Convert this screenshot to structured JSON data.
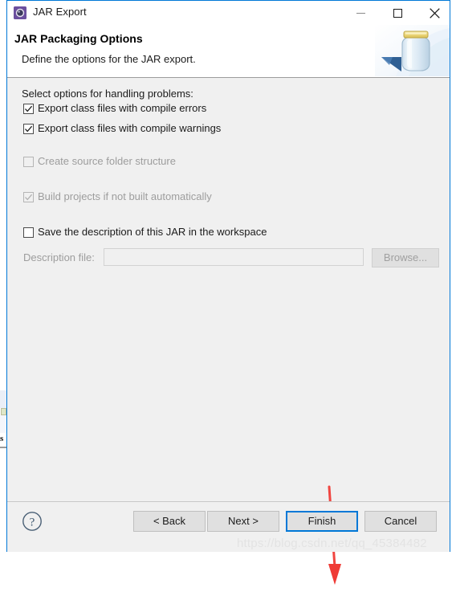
{
  "window": {
    "title": "JAR Export",
    "icon": "jar-export-icon",
    "controls": {
      "minimize": "minimize-icon",
      "maximize": "maximize-icon",
      "close": "close-icon"
    }
  },
  "header": {
    "title": "JAR Packaging Options",
    "subtitle": "Define the options for the JAR export.",
    "banner_icon": "jar-banner-icon"
  },
  "body": {
    "section_label": "Select options for handling problems:",
    "options": [
      {
        "label": "Export class files with compile errors",
        "checked": true,
        "enabled": true
      },
      {
        "label": "Export class files with compile warnings",
        "checked": true,
        "enabled": true
      },
      {
        "label": "Create source folder structure",
        "checked": false,
        "enabled": false
      },
      {
        "label": "Build projects if not built automatically",
        "checked": true,
        "enabled": false
      },
      {
        "label": "Save the description of this JAR in the workspace",
        "checked": false,
        "enabled": true
      }
    ],
    "description_file": {
      "label": "Description file:",
      "value": "",
      "placeholder": "",
      "browse_label": "Browse...",
      "enabled": false
    }
  },
  "footer": {
    "help_icon": "help-icon",
    "buttons": [
      {
        "label": "< Back",
        "name": "back-button",
        "default": false
      },
      {
        "label": "Next >",
        "name": "next-button",
        "default": false
      },
      {
        "label": "Finish",
        "name": "finish-button",
        "default": true
      },
      {
        "label": "Cancel",
        "name": "cancel-button",
        "default": false
      }
    ]
  },
  "annotation": {
    "arrow": "red-down-arrow",
    "arrow_color": "#ef3b36"
  },
  "watermark": {
    "text": "https://blog.csdn.net/qq_45384482"
  },
  "colors": {
    "accent": "#0078d7",
    "dialog_bg": "#f0f0f0",
    "header_bg": "#ffffff",
    "disabled_text": "#9d9d9d"
  },
  "artifacts": {
    "edge_char": "s"
  }
}
